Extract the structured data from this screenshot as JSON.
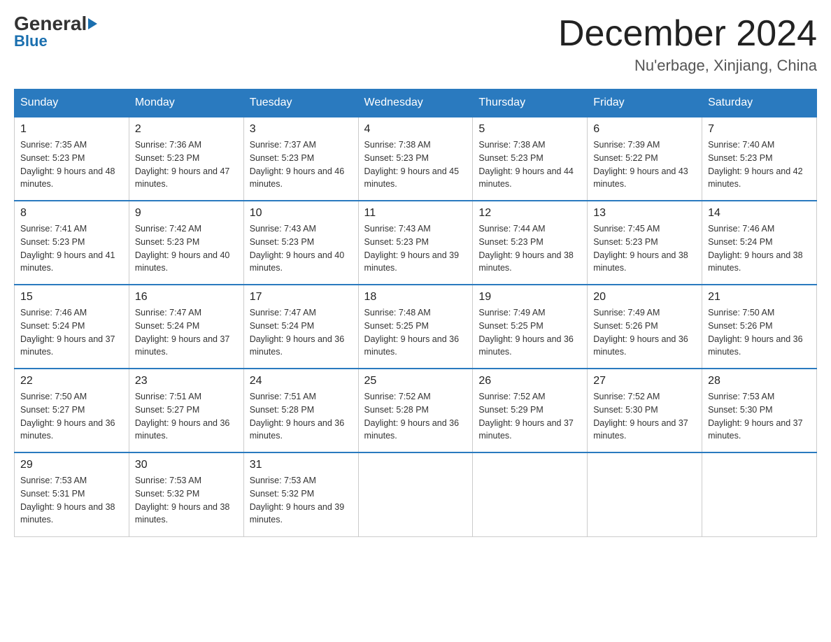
{
  "logo": {
    "general": "General",
    "arrow": "▶",
    "blue": "Blue"
  },
  "title": "December 2024",
  "location": "Nu'erbage, Xinjiang, China",
  "days_of_week": [
    "Sunday",
    "Monday",
    "Tuesday",
    "Wednesday",
    "Thursday",
    "Friday",
    "Saturday"
  ],
  "weeks": [
    [
      {
        "day": "1",
        "sunrise": "7:35 AM",
        "sunset": "5:23 PM",
        "daylight": "9 hours and 48 minutes."
      },
      {
        "day": "2",
        "sunrise": "7:36 AM",
        "sunset": "5:23 PM",
        "daylight": "9 hours and 47 minutes."
      },
      {
        "day": "3",
        "sunrise": "7:37 AM",
        "sunset": "5:23 PM",
        "daylight": "9 hours and 46 minutes."
      },
      {
        "day": "4",
        "sunrise": "7:38 AM",
        "sunset": "5:23 PM",
        "daylight": "9 hours and 45 minutes."
      },
      {
        "day": "5",
        "sunrise": "7:38 AM",
        "sunset": "5:23 PM",
        "daylight": "9 hours and 44 minutes."
      },
      {
        "day": "6",
        "sunrise": "7:39 AM",
        "sunset": "5:22 PM",
        "daylight": "9 hours and 43 minutes."
      },
      {
        "day": "7",
        "sunrise": "7:40 AM",
        "sunset": "5:23 PM",
        "daylight": "9 hours and 42 minutes."
      }
    ],
    [
      {
        "day": "8",
        "sunrise": "7:41 AM",
        "sunset": "5:23 PM",
        "daylight": "9 hours and 41 minutes."
      },
      {
        "day": "9",
        "sunrise": "7:42 AM",
        "sunset": "5:23 PM",
        "daylight": "9 hours and 40 minutes."
      },
      {
        "day": "10",
        "sunrise": "7:43 AM",
        "sunset": "5:23 PM",
        "daylight": "9 hours and 40 minutes."
      },
      {
        "day": "11",
        "sunrise": "7:43 AM",
        "sunset": "5:23 PM",
        "daylight": "9 hours and 39 minutes."
      },
      {
        "day": "12",
        "sunrise": "7:44 AM",
        "sunset": "5:23 PM",
        "daylight": "9 hours and 38 minutes."
      },
      {
        "day": "13",
        "sunrise": "7:45 AM",
        "sunset": "5:23 PM",
        "daylight": "9 hours and 38 minutes."
      },
      {
        "day": "14",
        "sunrise": "7:46 AM",
        "sunset": "5:24 PM",
        "daylight": "9 hours and 38 minutes."
      }
    ],
    [
      {
        "day": "15",
        "sunrise": "7:46 AM",
        "sunset": "5:24 PM",
        "daylight": "9 hours and 37 minutes."
      },
      {
        "day": "16",
        "sunrise": "7:47 AM",
        "sunset": "5:24 PM",
        "daylight": "9 hours and 37 minutes."
      },
      {
        "day": "17",
        "sunrise": "7:47 AM",
        "sunset": "5:24 PM",
        "daylight": "9 hours and 36 minutes."
      },
      {
        "day": "18",
        "sunrise": "7:48 AM",
        "sunset": "5:25 PM",
        "daylight": "9 hours and 36 minutes."
      },
      {
        "day": "19",
        "sunrise": "7:49 AM",
        "sunset": "5:25 PM",
        "daylight": "9 hours and 36 minutes."
      },
      {
        "day": "20",
        "sunrise": "7:49 AM",
        "sunset": "5:26 PM",
        "daylight": "9 hours and 36 minutes."
      },
      {
        "day": "21",
        "sunrise": "7:50 AM",
        "sunset": "5:26 PM",
        "daylight": "9 hours and 36 minutes."
      }
    ],
    [
      {
        "day": "22",
        "sunrise": "7:50 AM",
        "sunset": "5:27 PM",
        "daylight": "9 hours and 36 minutes."
      },
      {
        "day": "23",
        "sunrise": "7:51 AM",
        "sunset": "5:27 PM",
        "daylight": "9 hours and 36 minutes."
      },
      {
        "day": "24",
        "sunrise": "7:51 AM",
        "sunset": "5:28 PM",
        "daylight": "9 hours and 36 minutes."
      },
      {
        "day": "25",
        "sunrise": "7:52 AM",
        "sunset": "5:28 PM",
        "daylight": "9 hours and 36 minutes."
      },
      {
        "day": "26",
        "sunrise": "7:52 AM",
        "sunset": "5:29 PM",
        "daylight": "9 hours and 37 minutes."
      },
      {
        "day": "27",
        "sunrise": "7:52 AM",
        "sunset": "5:30 PM",
        "daylight": "9 hours and 37 minutes."
      },
      {
        "day": "28",
        "sunrise": "7:53 AM",
        "sunset": "5:30 PM",
        "daylight": "9 hours and 37 minutes."
      }
    ],
    [
      {
        "day": "29",
        "sunrise": "7:53 AM",
        "sunset": "5:31 PM",
        "daylight": "9 hours and 38 minutes."
      },
      {
        "day": "30",
        "sunrise": "7:53 AM",
        "sunset": "5:32 PM",
        "daylight": "9 hours and 38 minutes."
      },
      {
        "day": "31",
        "sunrise": "7:53 AM",
        "sunset": "5:32 PM",
        "daylight": "9 hours and 39 minutes."
      },
      null,
      null,
      null,
      null
    ]
  ]
}
